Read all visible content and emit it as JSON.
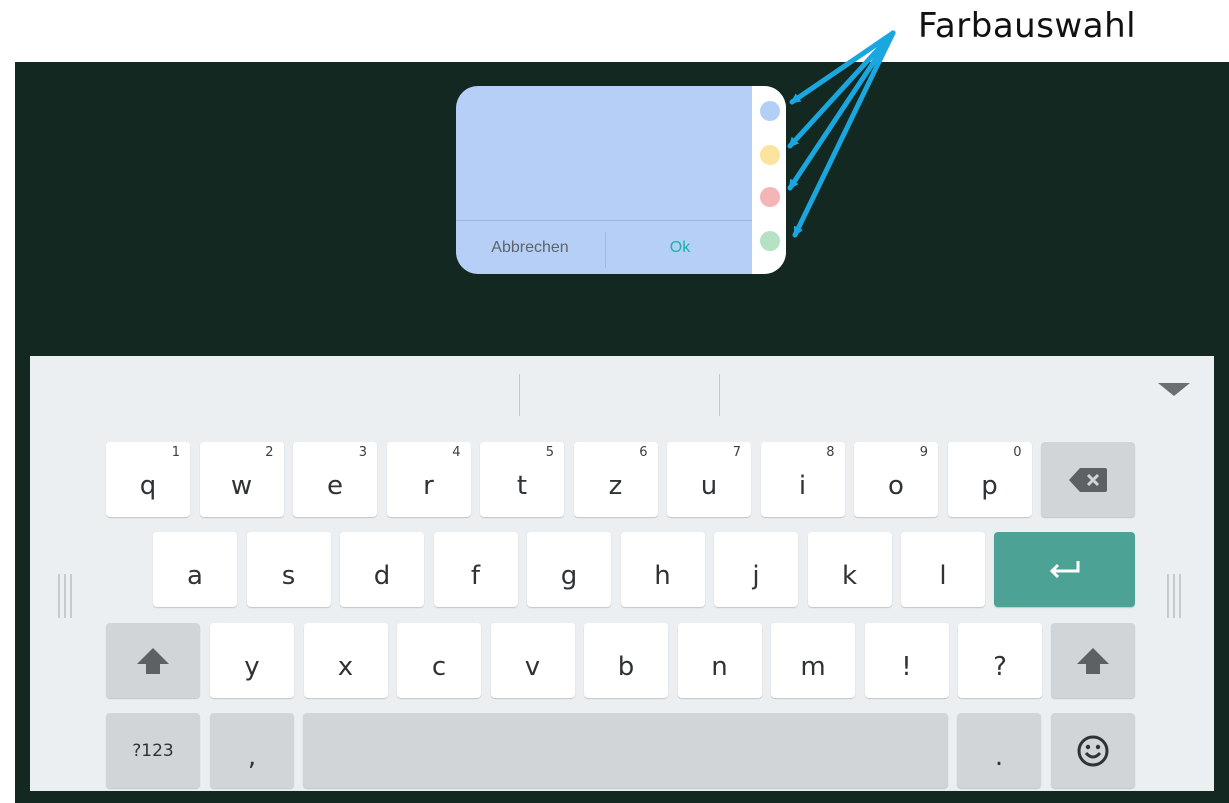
{
  "annotation": {
    "label": "Farbauswahl"
  },
  "note": {
    "cancel_label": "Abbrechen",
    "ok_label": "Ok",
    "colors": [
      "#b3cff5",
      "#fbe49e",
      "#f5b5b7",
      "#b5e2c4"
    ],
    "background": "#b5cff6"
  },
  "keyboard": {
    "row1": [
      {
        "key": "q",
        "hint": "1"
      },
      {
        "key": "w",
        "hint": "2"
      },
      {
        "key": "e",
        "hint": "3"
      },
      {
        "key": "r",
        "hint": "4"
      },
      {
        "key": "t",
        "hint": "5"
      },
      {
        "key": "z",
        "hint": "6"
      },
      {
        "key": "u",
        "hint": "7"
      },
      {
        "key": "i",
        "hint": "8"
      },
      {
        "key": "o",
        "hint": "9"
      },
      {
        "key": "p",
        "hint": "0"
      }
    ],
    "row2": [
      "a",
      "s",
      "d",
      "f",
      "g",
      "h",
      "j",
      "k",
      "l"
    ],
    "row3": [
      "y",
      "x",
      "c",
      "v",
      "b",
      "n",
      "m",
      "!",
      "?"
    ],
    "symbols_label": "?123",
    "comma_label": ",",
    "period_label": ".",
    "icons": {
      "backspace": "backspace-icon",
      "enter": "enter-icon",
      "shift": "shift-icon",
      "emoji": "emoji-icon",
      "hide": "chevron-down-icon"
    },
    "enter_color": "#4ca294"
  }
}
